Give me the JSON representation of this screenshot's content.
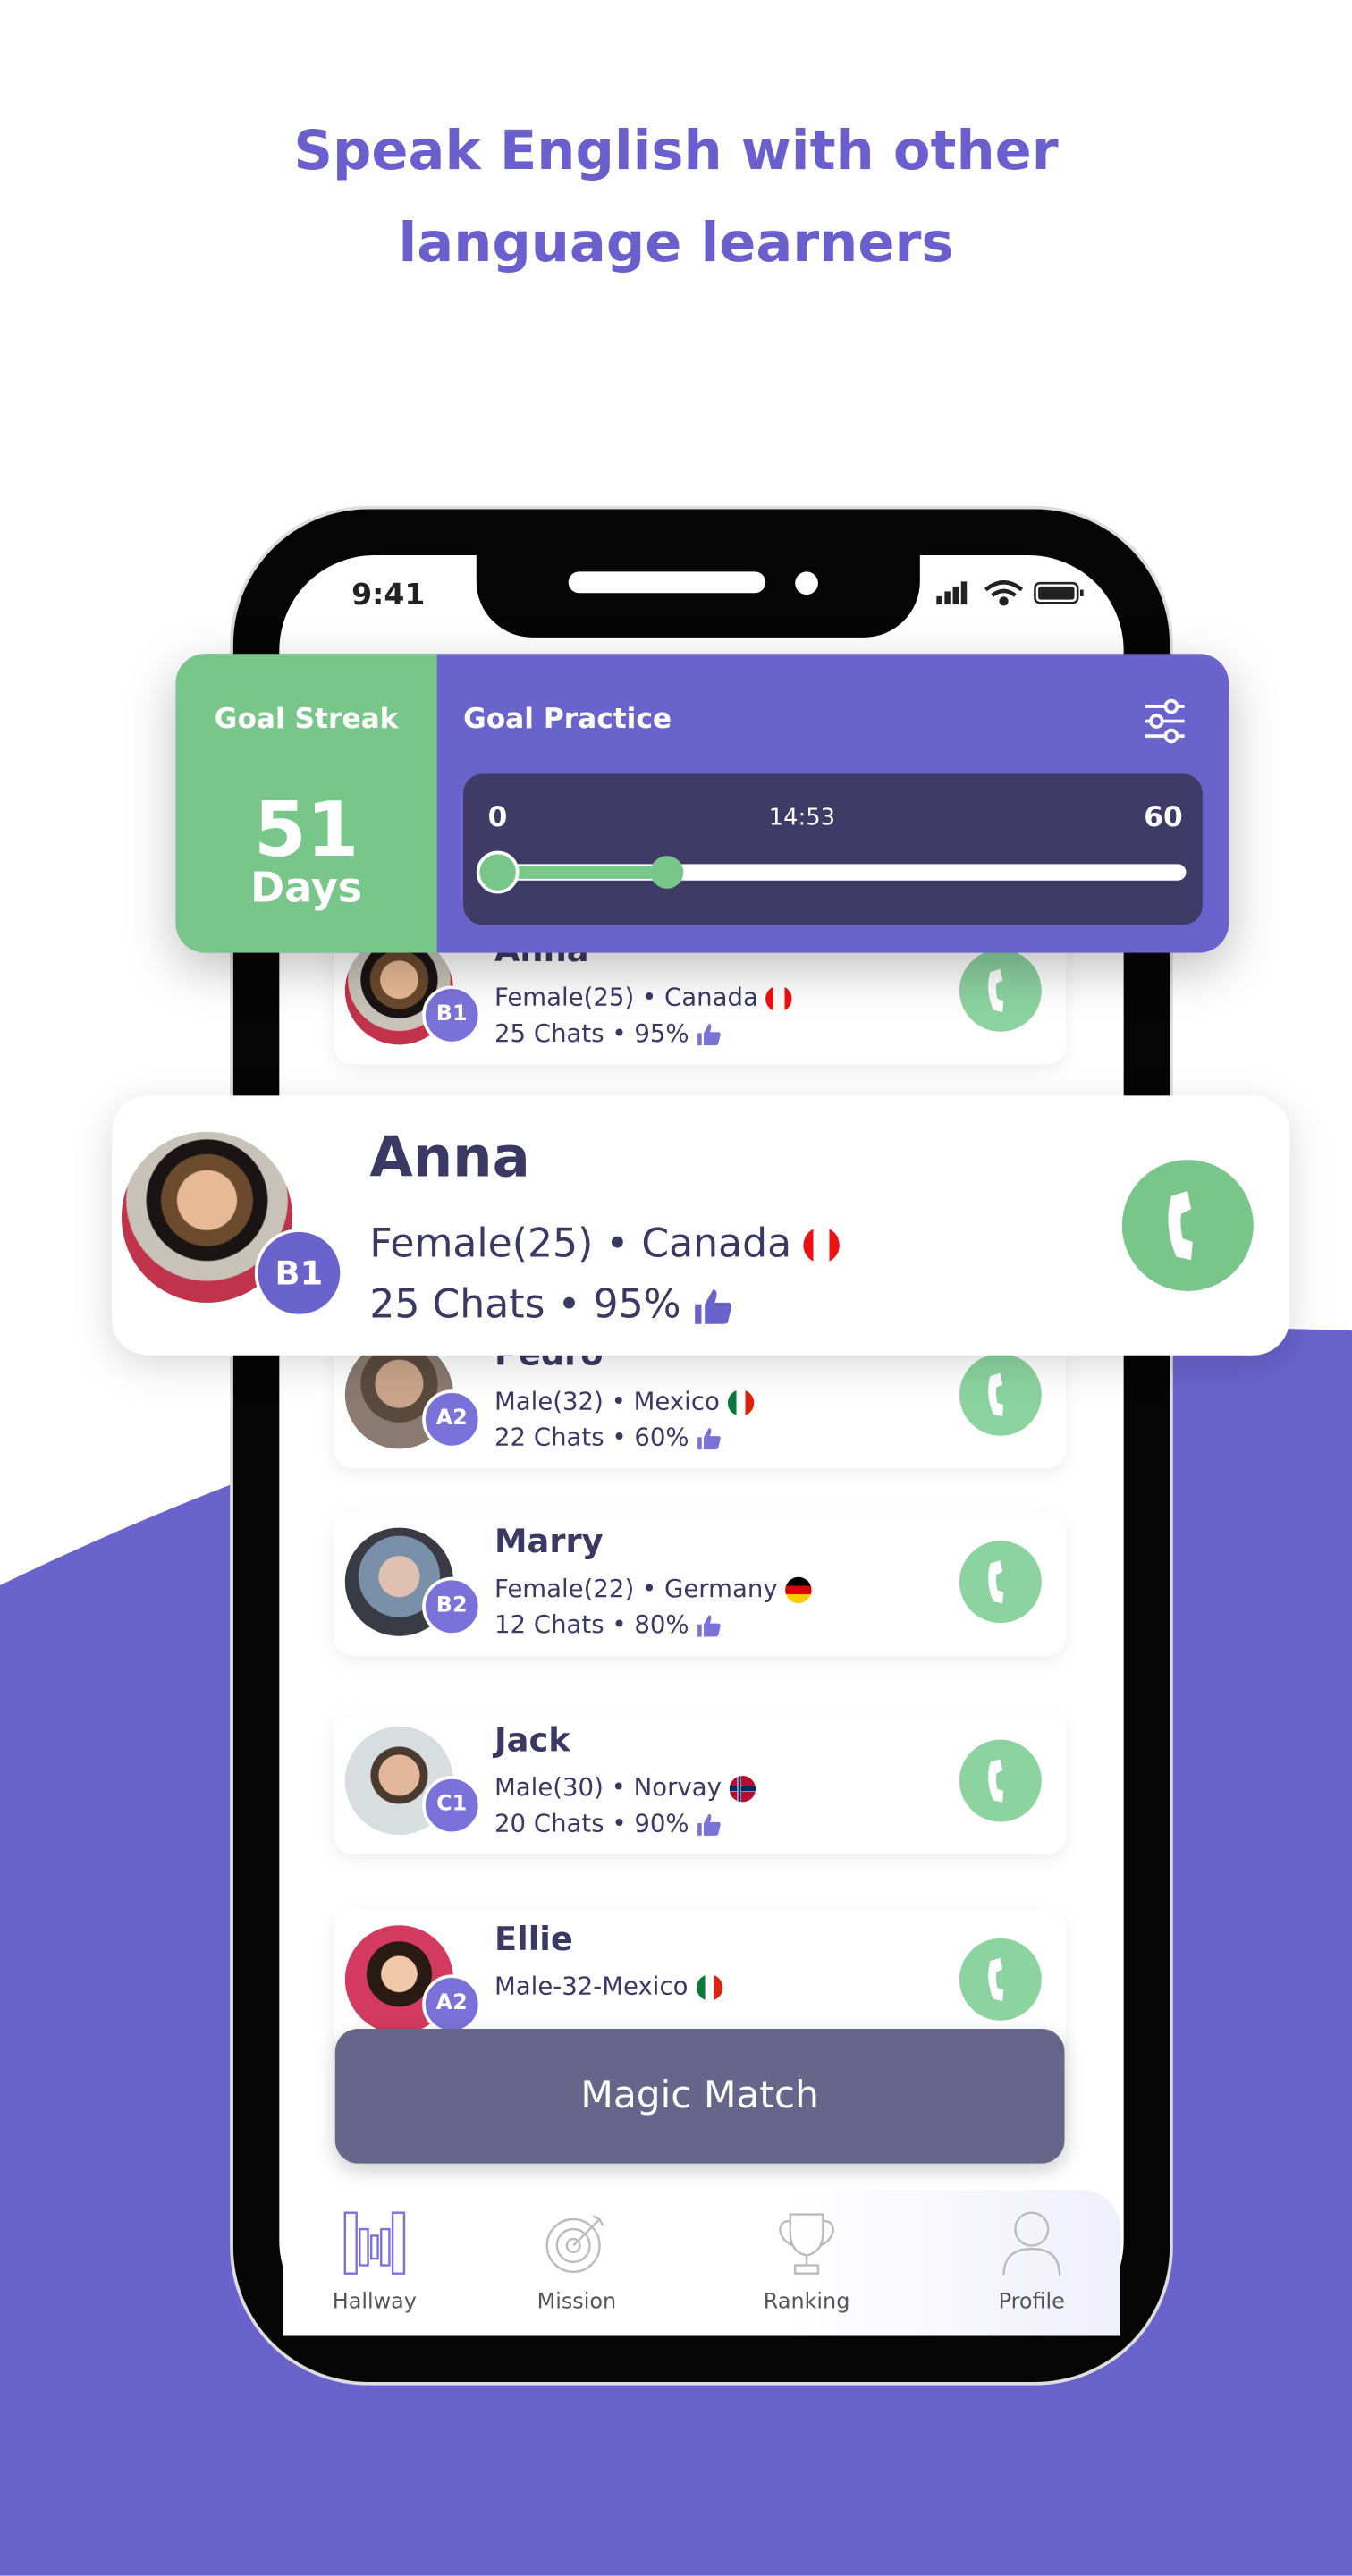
{
  "headline": {
    "line1": "Speak English with other",
    "line2": "language learners"
  },
  "colors": {
    "brand_purple": "#6a63cc",
    "green": "#78c68a",
    "dark_panel": "#3f3b66",
    "magic_button": "#67668a",
    "text_dark": "#3b3863"
  },
  "status_bar": {
    "time": "9:41",
    "icons": [
      "signal-icon",
      "wifi-icon",
      "battery-icon"
    ]
  },
  "goal_card": {
    "streak_title": "Goal Streak",
    "streak_value": "51",
    "streak_unit": "Days",
    "practice_title": "Goal Practice",
    "settings_icon": "sliders-icon",
    "slider": {
      "min_label": "0",
      "current_label": "14:53",
      "max_label": "60",
      "min": 0,
      "max": 60,
      "value_minutes": 14.88
    }
  },
  "featured_user": {
    "name": "Anna",
    "level": "B1",
    "details": "Female(25) • Canada",
    "country_flag": "canada",
    "chats": "25 Chats • 95%"
  },
  "users": [
    {
      "name": "Anna",
      "level": "B1",
      "details": "Female(25) • Canada",
      "country_flag": "canada",
      "chats": "25 Chats • 95%"
    },
    {
      "name": "Pedro",
      "level": "A2",
      "details": "Male(32) • Mexico",
      "country_flag": "mexico",
      "chats": "22 Chats • 60%"
    },
    {
      "name": "Marry",
      "level": "B2",
      "details": "Female(22) • Germany",
      "country_flag": "germany",
      "chats": "12 Chats • 80%"
    },
    {
      "name": "Jack",
      "level": "C1",
      "details": "Male(30) • Norvay",
      "country_flag": "norway",
      "chats": "20 Chats • 90%"
    },
    {
      "name": "Ellie",
      "level": "A2",
      "details": "Male-32-Mexico",
      "country_flag": "mexico",
      "chats": ""
    }
  ],
  "magic_match": {
    "label": "Magic Match"
  },
  "nav": {
    "items": [
      {
        "label": "Hallway",
        "icon": "hallway-icon",
        "active": true
      },
      {
        "label": "Mission",
        "icon": "target-icon",
        "active": false
      },
      {
        "label": "Ranking",
        "icon": "trophy-icon",
        "active": false
      },
      {
        "label": "Profile",
        "icon": "person-icon",
        "active": false
      }
    ]
  }
}
